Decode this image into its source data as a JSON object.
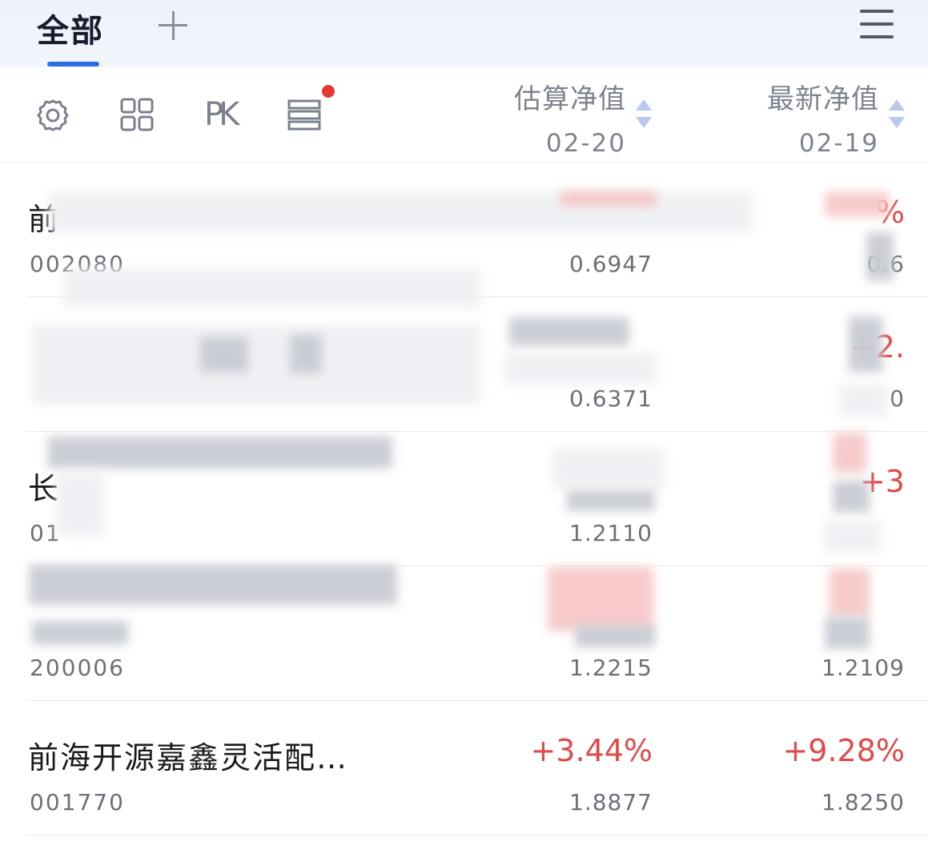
{
  "tabs": {
    "active_label": "全部",
    "add_icon": "plus-icon",
    "menu_icon": "hamburger-menu-icon"
  },
  "toolbar": {
    "settings_icon": "gear-icon",
    "grid_icon": "grid-icon",
    "pk_label": "PK",
    "list_icon": "list-icon",
    "badge_color": "#e53935"
  },
  "columns": {
    "estimated": {
      "title": "估算净值",
      "date": "02-20"
    },
    "latest": {
      "title": "最新净值",
      "date": "02-19"
    }
  },
  "colors": {
    "accent": "#2f6be3",
    "up": "#e04a4a",
    "muted": "#6b7078"
  },
  "funds": [
    {
      "name": "前",
      "code": "002080",
      "est_pct": "",
      "est_nav": "0.6947",
      "lat_pct": "%",
      "lat_nav": "0.6"
    },
    {
      "name": "",
      "code": "",
      "est_pct": "",
      "est_nav": "0.6371",
      "lat_pct": "+2.",
      "lat_nav": "0"
    },
    {
      "name": "长",
      "code": "01",
      "est_pct": "",
      "est_nav": "1.2110",
      "lat_pct": "+3",
      "lat_nav": ""
    },
    {
      "name": "",
      "code": "200006",
      "est_pct": "",
      "est_nav": "1.2215",
      "lat_pct": "",
      "lat_nav": "1.2109"
    },
    {
      "name": "前海开源嘉鑫灵活配…",
      "code": "001770",
      "est_pct": "+3.44%",
      "est_nav": "1.8877",
      "lat_pct": "+9.28%",
      "lat_nav": "1.8250"
    }
  ]
}
